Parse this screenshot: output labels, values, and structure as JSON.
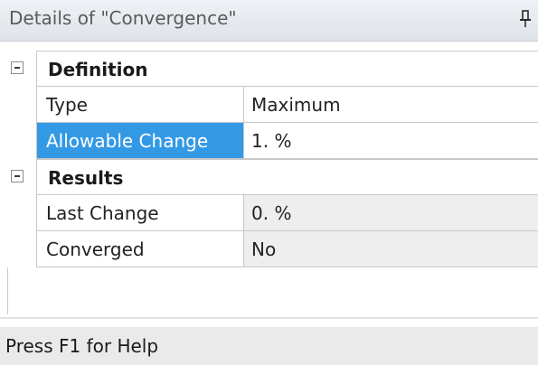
{
  "panel": {
    "title": "Details of \"Convergence\"",
    "pin_icon": "pin-icon"
  },
  "groups": [
    {
      "label": "Definition",
      "expander_icon": "collapse-minus-icon",
      "properties": [
        {
          "name": "Type",
          "value": "Maximum",
          "selected": false,
          "readonly": false
        },
        {
          "name": "Allowable Change",
          "value": "1. %",
          "selected": true,
          "readonly": false
        }
      ]
    },
    {
      "label": "Results",
      "expander_icon": "collapse-minus-icon",
      "properties": [
        {
          "name": "Last Change",
          "value": "0. %",
          "selected": false,
          "readonly": true
        },
        {
          "name": "Converged",
          "value": "No",
          "selected": false,
          "readonly": true
        }
      ]
    }
  ],
  "status_bar": {
    "text": "Press F1 for Help"
  },
  "colors": {
    "selection": "#3399e5",
    "readonly_bg": "#eeeeee"
  }
}
